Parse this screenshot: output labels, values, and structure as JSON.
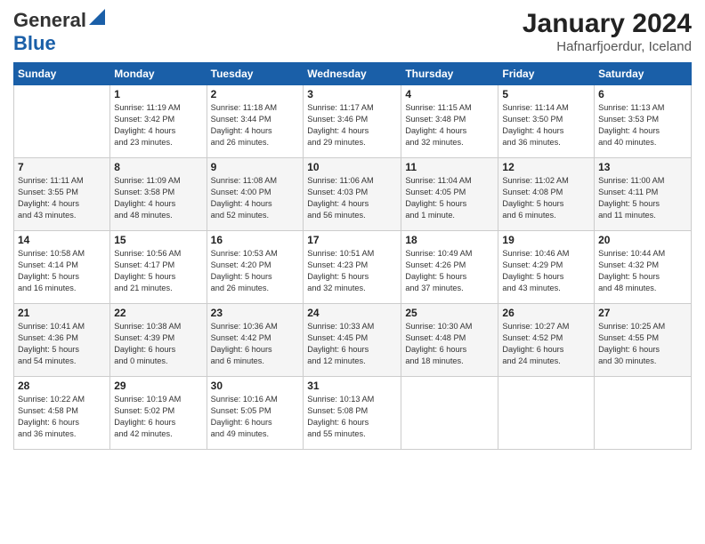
{
  "header": {
    "logo_general": "General",
    "logo_blue": "Blue",
    "month_year": "January 2024",
    "location": "Hafnarfjoerdur, Iceland"
  },
  "days_of_week": [
    "Sunday",
    "Monday",
    "Tuesday",
    "Wednesday",
    "Thursday",
    "Friday",
    "Saturday"
  ],
  "weeks": [
    [
      {
        "day": "",
        "info": ""
      },
      {
        "day": "1",
        "info": "Sunrise: 11:19 AM\nSunset: 3:42 PM\nDaylight: 4 hours\nand 23 minutes."
      },
      {
        "day": "2",
        "info": "Sunrise: 11:18 AM\nSunset: 3:44 PM\nDaylight: 4 hours\nand 26 minutes."
      },
      {
        "day": "3",
        "info": "Sunrise: 11:17 AM\nSunset: 3:46 PM\nDaylight: 4 hours\nand 29 minutes."
      },
      {
        "day": "4",
        "info": "Sunrise: 11:15 AM\nSunset: 3:48 PM\nDaylight: 4 hours\nand 32 minutes."
      },
      {
        "day": "5",
        "info": "Sunrise: 11:14 AM\nSunset: 3:50 PM\nDaylight: 4 hours\nand 36 minutes."
      },
      {
        "day": "6",
        "info": "Sunrise: 11:13 AM\nSunset: 3:53 PM\nDaylight: 4 hours\nand 40 minutes."
      }
    ],
    [
      {
        "day": "7",
        "info": "Sunrise: 11:11 AM\nSunset: 3:55 PM\nDaylight: 4 hours\nand 43 minutes."
      },
      {
        "day": "8",
        "info": "Sunrise: 11:09 AM\nSunset: 3:58 PM\nDaylight: 4 hours\nand 48 minutes."
      },
      {
        "day": "9",
        "info": "Sunrise: 11:08 AM\nSunset: 4:00 PM\nDaylight: 4 hours\nand 52 minutes."
      },
      {
        "day": "10",
        "info": "Sunrise: 11:06 AM\nSunset: 4:03 PM\nDaylight: 4 hours\nand 56 minutes."
      },
      {
        "day": "11",
        "info": "Sunrise: 11:04 AM\nSunset: 4:05 PM\nDaylight: 5 hours\nand 1 minute."
      },
      {
        "day": "12",
        "info": "Sunrise: 11:02 AM\nSunset: 4:08 PM\nDaylight: 5 hours\nand 6 minutes."
      },
      {
        "day": "13",
        "info": "Sunrise: 11:00 AM\nSunset: 4:11 PM\nDaylight: 5 hours\nand 11 minutes."
      }
    ],
    [
      {
        "day": "14",
        "info": "Sunrise: 10:58 AM\nSunset: 4:14 PM\nDaylight: 5 hours\nand 16 minutes."
      },
      {
        "day": "15",
        "info": "Sunrise: 10:56 AM\nSunset: 4:17 PM\nDaylight: 5 hours\nand 21 minutes."
      },
      {
        "day": "16",
        "info": "Sunrise: 10:53 AM\nSunset: 4:20 PM\nDaylight: 5 hours\nand 26 minutes."
      },
      {
        "day": "17",
        "info": "Sunrise: 10:51 AM\nSunset: 4:23 PM\nDaylight: 5 hours\nand 32 minutes."
      },
      {
        "day": "18",
        "info": "Sunrise: 10:49 AM\nSunset: 4:26 PM\nDaylight: 5 hours\nand 37 minutes."
      },
      {
        "day": "19",
        "info": "Sunrise: 10:46 AM\nSunset: 4:29 PM\nDaylight: 5 hours\nand 43 minutes."
      },
      {
        "day": "20",
        "info": "Sunrise: 10:44 AM\nSunset: 4:32 PM\nDaylight: 5 hours\nand 48 minutes."
      }
    ],
    [
      {
        "day": "21",
        "info": "Sunrise: 10:41 AM\nSunset: 4:36 PM\nDaylight: 5 hours\nand 54 minutes."
      },
      {
        "day": "22",
        "info": "Sunrise: 10:38 AM\nSunset: 4:39 PM\nDaylight: 6 hours\nand 0 minutes."
      },
      {
        "day": "23",
        "info": "Sunrise: 10:36 AM\nSunset: 4:42 PM\nDaylight: 6 hours\nand 6 minutes."
      },
      {
        "day": "24",
        "info": "Sunrise: 10:33 AM\nSunset: 4:45 PM\nDaylight: 6 hours\nand 12 minutes."
      },
      {
        "day": "25",
        "info": "Sunrise: 10:30 AM\nSunset: 4:48 PM\nDaylight: 6 hours\nand 18 minutes."
      },
      {
        "day": "26",
        "info": "Sunrise: 10:27 AM\nSunset: 4:52 PM\nDaylight: 6 hours\nand 24 minutes."
      },
      {
        "day": "27",
        "info": "Sunrise: 10:25 AM\nSunset: 4:55 PM\nDaylight: 6 hours\nand 30 minutes."
      }
    ],
    [
      {
        "day": "28",
        "info": "Sunrise: 10:22 AM\nSunset: 4:58 PM\nDaylight: 6 hours\nand 36 minutes."
      },
      {
        "day": "29",
        "info": "Sunrise: 10:19 AM\nSunset: 5:02 PM\nDaylight: 6 hours\nand 42 minutes."
      },
      {
        "day": "30",
        "info": "Sunrise: 10:16 AM\nSunset: 5:05 PM\nDaylight: 6 hours\nand 49 minutes."
      },
      {
        "day": "31",
        "info": "Sunrise: 10:13 AM\nSunset: 5:08 PM\nDaylight: 6 hours\nand 55 minutes."
      },
      {
        "day": "",
        "info": ""
      },
      {
        "day": "",
        "info": ""
      },
      {
        "day": "",
        "info": ""
      }
    ]
  ]
}
